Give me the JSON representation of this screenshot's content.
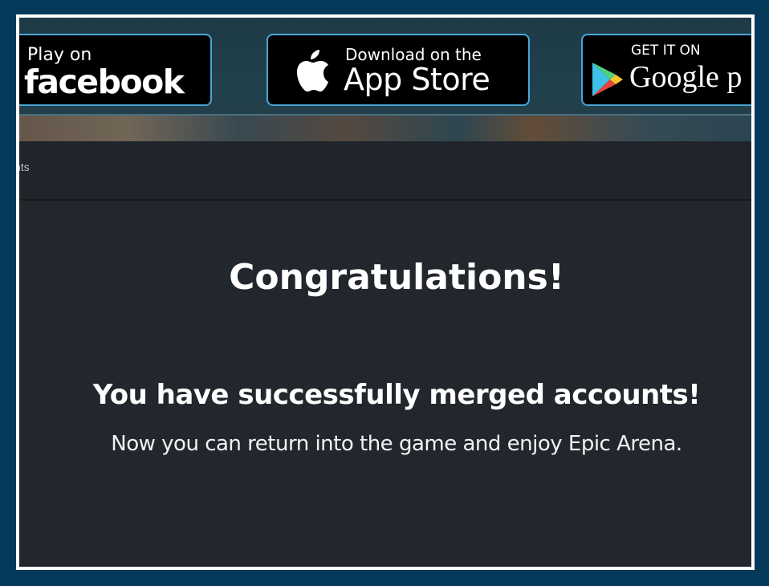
{
  "stores": {
    "facebook": {
      "top": "Play on",
      "big": "facebook",
      "icon": "facebook-wordmark"
    },
    "apple": {
      "top": "Download on the",
      "big": "App Store",
      "icon": "apple-icon"
    },
    "google": {
      "top": "GET IT ON",
      "big": "Google p",
      "icon": "google-play-icon"
    }
  },
  "subnav": {
    "partial_text": "nts"
  },
  "main": {
    "title": "Congratulations!",
    "subtitle": "You have successfully merged accounts!",
    "message": "Now you can return into the game and enjoy Epic Arena."
  },
  "colors": {
    "page_border": "#063a5a",
    "frame": "#ffffff",
    "button_border": "#4aa6d6",
    "content_bg": "#22272e"
  }
}
